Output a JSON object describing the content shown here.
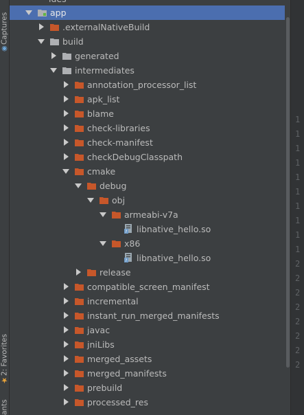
{
  "side_tabs": {
    "captures": "Captures",
    "favorites": "2: Favorites",
    "variants": "ants"
  },
  "partial_top_label": "ides",
  "tree": [
    {
      "label": "app",
      "expanded": true,
      "icon": "module-folder-icon",
      "selected": true
    },
    {
      "label": ".externalNativeBuild",
      "expanded": false,
      "icon": "folder-orange-icon"
    },
    {
      "label": "build",
      "expanded": true,
      "icon": "folder-grey-icon"
    },
    {
      "label": "generated",
      "expanded": false,
      "icon": "folder-grey-icon"
    },
    {
      "label": "intermediates",
      "expanded": true,
      "icon": "folder-grey-icon"
    },
    {
      "label": "annotation_processor_list",
      "expanded": false,
      "icon": "folder-orange-icon"
    },
    {
      "label": "apk_list",
      "expanded": false,
      "icon": "folder-orange-icon"
    },
    {
      "label": "blame",
      "expanded": false,
      "icon": "folder-orange-icon"
    },
    {
      "label": "check-libraries",
      "expanded": false,
      "icon": "folder-orange-icon"
    },
    {
      "label": "check-manifest",
      "expanded": false,
      "icon": "folder-orange-icon"
    },
    {
      "label": "checkDebugClasspath",
      "expanded": false,
      "icon": "folder-orange-icon"
    },
    {
      "label": "cmake",
      "expanded": true,
      "icon": "folder-orange-icon"
    },
    {
      "label": "debug",
      "expanded": true,
      "icon": "folder-orange-icon"
    },
    {
      "label": "obj",
      "expanded": true,
      "icon": "folder-orange-icon"
    },
    {
      "label": "armeabi-v7a",
      "expanded": true,
      "icon": "folder-orange-icon"
    },
    {
      "label": "libnative_hello.so",
      "expanded": null,
      "icon": "file-unknown-icon"
    },
    {
      "label": "x86",
      "expanded": true,
      "icon": "folder-orange-icon"
    },
    {
      "label": "libnative_hello.so",
      "expanded": null,
      "icon": "file-unknown-icon"
    },
    {
      "label": "release",
      "expanded": false,
      "icon": "folder-orange-icon"
    },
    {
      "label": "compatible_screen_manifest",
      "expanded": false,
      "icon": "folder-orange-icon"
    },
    {
      "label": "incremental",
      "expanded": false,
      "icon": "folder-orange-icon"
    },
    {
      "label": "instant_run_merged_manifests",
      "expanded": false,
      "icon": "folder-orange-icon"
    },
    {
      "label": "javac",
      "expanded": false,
      "icon": "folder-orange-icon"
    },
    {
      "label": "jniLibs",
      "expanded": false,
      "icon": "folder-orange-icon"
    },
    {
      "label": "merged_assets",
      "expanded": false,
      "icon": "folder-orange-icon"
    },
    {
      "label": "merged_manifests",
      "expanded": false,
      "icon": "folder-orange-icon"
    },
    {
      "label": "prebuild",
      "expanded": false,
      "icon": "folder-orange-icon"
    },
    {
      "label": "processed_res",
      "expanded": false,
      "icon": "folder-orange-icon"
    }
  ],
  "gutter_numbers": [
    "1",
    "1",
    "1",
    "1",
    "1",
    "1",
    "1",
    "1",
    "1",
    "1",
    "2",
    "2",
    "2",
    "2",
    "2",
    "2",
    "2",
    "2"
  ],
  "colors": {
    "selection": "#4b6eaf",
    "folder_orange": "#c7572a",
    "folder_grey": "#aeb0b3",
    "background": "#3c3f41"
  }
}
